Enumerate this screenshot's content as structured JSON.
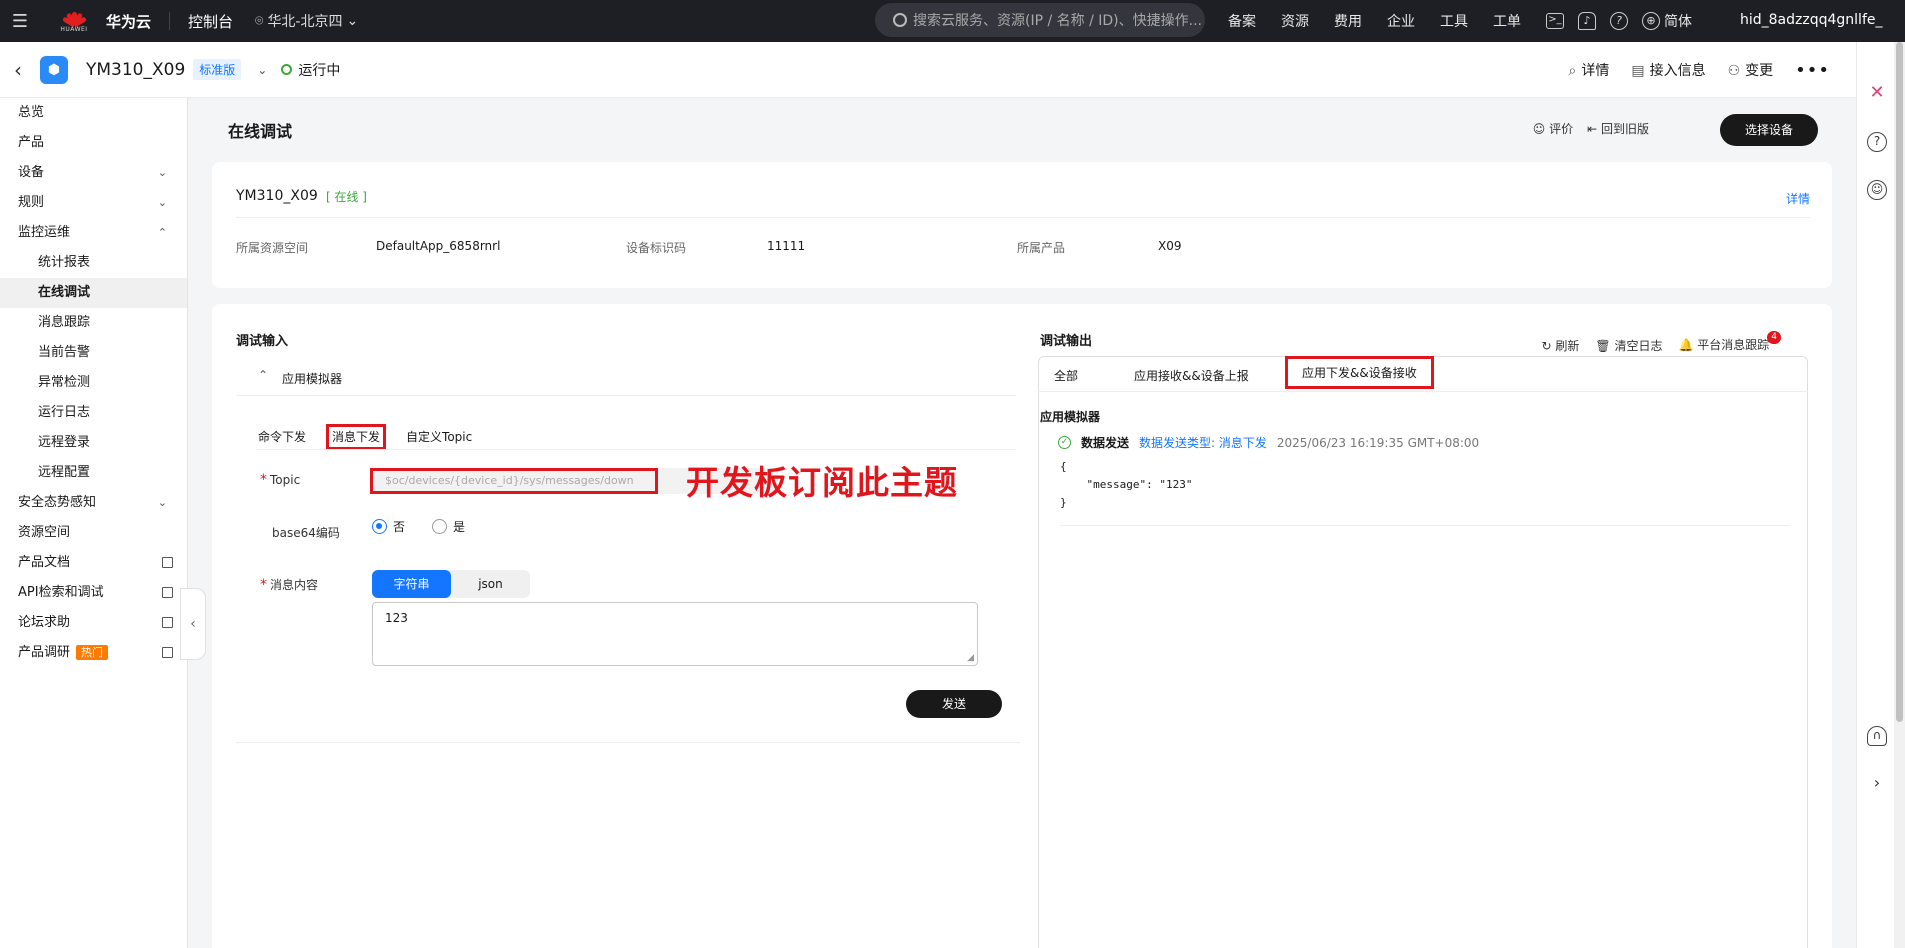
{
  "topbar": {
    "logo_text": "HUAWEI",
    "brand": "华为云",
    "console": "控制台",
    "region": "华北-北京四",
    "search_placeholder": "搜索云服务、资源(IP / 名称 / ID)、快捷操作...",
    "nav": [
      "备案",
      "资源",
      "费用",
      "企业",
      "工具",
      "工单"
    ],
    "lang": "简体",
    "user": "hid_8adzzqq4gnllfe_"
  },
  "device_header": {
    "name": "YM310_X09",
    "edition": "标准版",
    "status": "运行中",
    "actions": [
      "详情",
      "接入信息",
      "变更"
    ]
  },
  "sidebar": {
    "items": [
      {
        "label": "总览",
        "type": "top"
      },
      {
        "label": "产品",
        "type": "top"
      },
      {
        "label": "设备",
        "type": "expand"
      },
      {
        "label": "规则",
        "type": "expand"
      },
      {
        "label": "监控运维",
        "type": "collapse"
      },
      {
        "label": "统计报表",
        "type": "sub"
      },
      {
        "label": "在线调试",
        "type": "sub-active"
      },
      {
        "label": "消息跟踪",
        "type": "sub"
      },
      {
        "label": "当前告警",
        "type": "sub"
      },
      {
        "label": "异常检测",
        "type": "sub"
      },
      {
        "label": "运行日志",
        "type": "sub"
      },
      {
        "label": "远程登录",
        "type": "sub"
      },
      {
        "label": "远程配置",
        "type": "sub"
      },
      {
        "label": "安全态势感知",
        "type": "expand"
      },
      {
        "label": "资源空间",
        "type": "top"
      },
      {
        "label": "产品文档",
        "type": "ext"
      },
      {
        "label": "API检索和调试",
        "type": "ext"
      },
      {
        "label": "论坛求助",
        "type": "ext"
      },
      {
        "label": "产品调研",
        "type": "ext-hot"
      }
    ],
    "hot_label": "热门"
  },
  "page": {
    "title": "在线调试",
    "rate": "评价",
    "back_old": "回到旧版",
    "select_device": "选择设备"
  },
  "device_card": {
    "name": "YM310_X09",
    "online": "[ 在线 ]",
    "detail": "详情",
    "fields": [
      {
        "label": "所属资源空间",
        "value": "DefaultApp_6858rnrl"
      },
      {
        "label": "设备标识码",
        "value": "11111"
      },
      {
        "label": "所属产品",
        "value": "X09"
      }
    ]
  },
  "debug_input": {
    "title": "调试输入",
    "simulator": "应用模拟器",
    "tabs": [
      "命令下发",
      "消息下发",
      "自定义Topic"
    ],
    "active_tab": "消息下发",
    "topic_label": "Topic",
    "topic_placeholder": "$oc/devices/{device_id}/sys/messages/down",
    "annotation": "开发板订阅此主题",
    "base64_label": "base64编码",
    "base64_options": [
      "否",
      "是"
    ],
    "content_label": "消息内容",
    "content_types": [
      "字符串",
      "json"
    ],
    "content_value": "123",
    "send": "发送"
  },
  "debug_output": {
    "title": "调试输出",
    "refresh": "刷新",
    "clear": "清空日志",
    "trace": "平台消息跟踪",
    "trace_badge": "4",
    "tabs": [
      "全部",
      "应用接收&&设备上报",
      "应用下发&&设备接收"
    ],
    "active_tab": "应用下发&&设备接收",
    "section": "应用模拟器",
    "log_action": "数据发送",
    "log_type": "数据发送类型: 消息下发",
    "log_time": "2025/06/23 16:19:35 GMT+08:00",
    "log_body": "{\n    \"message\": \"123\"\n}"
  },
  "colors": {
    "accent": "#1476ff",
    "highlight": "#e0161c",
    "success": "#3ca83c",
    "topbar": "#1d1f24"
  }
}
